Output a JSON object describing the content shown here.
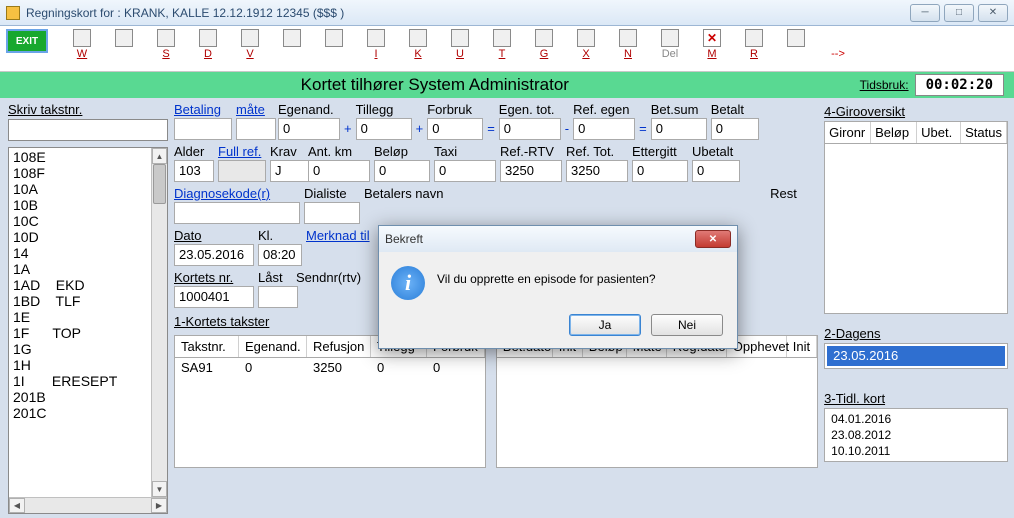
{
  "window": {
    "title": "Regningskort for :  KRANK, KALLE 12.12.1912 12345 ($$$ )"
  },
  "toolbar": {
    "exit": "EXIT",
    "items": [
      {
        "label": "W"
      },
      {
        "label": ""
      },
      {
        "label": "S"
      },
      {
        "label": "D"
      },
      {
        "label": "V"
      },
      {
        "label": ""
      },
      {
        "label": ""
      },
      {
        "label": "I"
      },
      {
        "label": "K"
      },
      {
        "label": "U"
      },
      {
        "label": "T"
      },
      {
        "label": "G"
      },
      {
        "label": "X"
      },
      {
        "label": "N"
      },
      {
        "label": "Del"
      },
      {
        "label": "M"
      },
      {
        "label": "R"
      },
      {
        "label": ""
      },
      {
        "label": "-->"
      }
    ]
  },
  "ownerbar": {
    "text": "Kortet tilhører System Administrator",
    "tidsbruk_label": "Tidsbruk:",
    "tidsbruk_value": "00:02:20"
  },
  "left": {
    "label": "Skriv takstnr.",
    "value": "",
    "items": [
      "108E",
      "108F",
      "10A",
      "10B",
      "10C",
      "10D",
      "14",
      "1A",
      "1AD    EKD",
      "1BD    TLF",
      "1E",
      "1F      TOP",
      "1G",
      "1H",
      "1I       ERESEPT",
      "201B",
      "201C"
    ]
  },
  "fields": {
    "betaling_label": "Betaling",
    "betaling_value": "",
    "mate_label": "måte",
    "mate_value": "",
    "egenand_label": "Egenand.",
    "egenand_value": "0",
    "tillegg_label": "Tillegg",
    "tillegg_value": "0",
    "forbruk_label": "Forbruk",
    "forbruk_value": "0",
    "egentot_label": "Egen. tot.",
    "egentot_value": "0",
    "refegen_label": "Ref. egen",
    "refegen_value": "0",
    "betsum_label": "Bet.sum",
    "betsum_value": "0",
    "betalt_label": "Betalt",
    "betalt_value": "0",
    "alder_label": "Alder",
    "alder_value": "103",
    "fullref_label": "Full ref.",
    "fullref_value": "",
    "krav_label": "Krav",
    "krav_value": "J",
    "antkm_label": "Ant. km",
    "antkm_value": "0",
    "belop_label": "Beløp",
    "belop_value": "0",
    "taxi_label": "Taxi",
    "taxi_value": "0",
    "refrtv_label": "Ref.-RTV",
    "refrtv_value": "3250",
    "reftot_label": "Ref. Tot.",
    "reftot_value": "3250",
    "ettergitt_label": "Ettergitt",
    "ettergitt_value": "0",
    "ubetalt_label": "Ubetalt",
    "ubetalt_value": "0",
    "diagnosekode_label": "Diagnosekode(r)",
    "diagnosekode_value": "",
    "dialiste_label": "Dialiste",
    "betalersnavn_label": "Betalers navn",
    "rest_label": "Rest",
    "dato_label": "Dato",
    "dato_value": "23.05.2016",
    "kl_label": "Kl.",
    "kl_value": "08:20",
    "merknad_label": "Merknad til",
    "kortetsnr_label": "Kortets nr.",
    "kortetsnr_value": "1000401",
    "last_label": "Låst",
    "sendnr_label": "Sendnr(rtv)"
  },
  "kortets_takster": {
    "title": "1-Kortets takster",
    "headers": [
      "Takstnr.",
      "Egenand.",
      "Refusjon",
      "Tillegg",
      "Forbruk"
    ],
    "rows": [
      {
        "takstnr": "SA91",
        "egenand": "0",
        "refusjon": "3250",
        "tillegg": "0",
        "forbruk": "0"
      }
    ]
  },
  "betalinger": {
    "headers": [
      "Bet.dato",
      "Init",
      "Beløp",
      "Måte",
      "Reg.dato",
      "Opphevet",
      "Init"
    ]
  },
  "giro": {
    "title": "4-Girooversikt",
    "headers": [
      "Gironr",
      "Beløp",
      "Ubet.",
      "Status"
    ]
  },
  "dagens": {
    "title": "2-Dagens",
    "items": [
      "23.05.2016"
    ]
  },
  "tidl": {
    "title": "3-Tidl. kort",
    "items": [
      "04.01.2016",
      "23.08.2012",
      "10.10.2011"
    ]
  },
  "dialog": {
    "title": "Bekreft",
    "text": "Vil du opprette en episode for pasienten?",
    "yes": "Ja",
    "no": "Nei"
  }
}
